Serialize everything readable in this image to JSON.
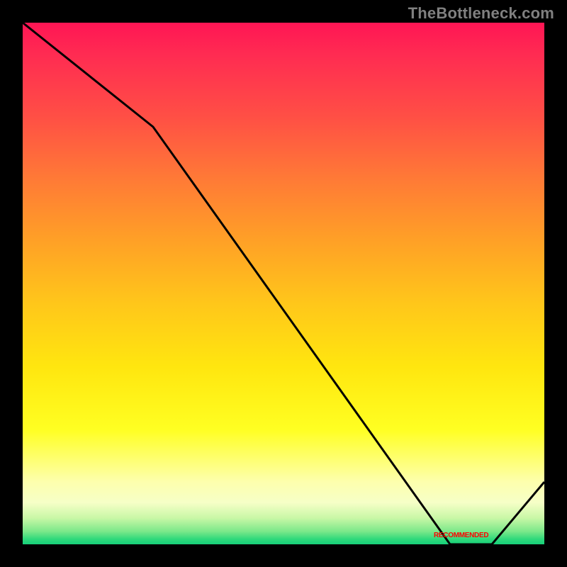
{
  "watermark": "TheBottleneck.com",
  "chart_data": {
    "type": "line",
    "title": "",
    "xlabel": "",
    "ylabel": "",
    "xlim": [
      0,
      100
    ],
    "ylim": [
      0,
      100
    ],
    "series": [
      {
        "name": "curve",
        "x": [
          0,
          25,
          82,
          90,
          100
        ],
        "values": [
          100,
          80,
          0,
          0,
          12
        ]
      }
    ],
    "annotations": [
      {
        "text": "RECOMMENDED",
        "x": 84,
        "y": 1
      }
    ]
  },
  "colors": {
    "curve": "#000000",
    "annotation": "#ff0000",
    "watermark": "#808080",
    "frame": "#000000"
  }
}
